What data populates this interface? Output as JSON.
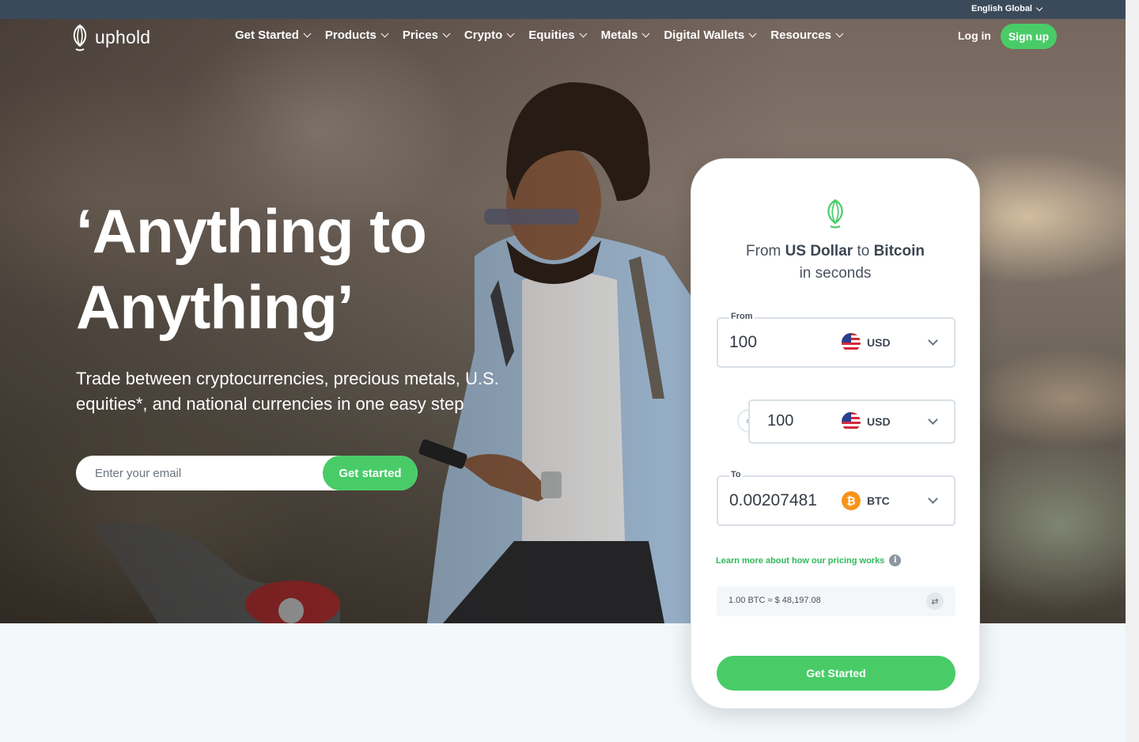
{
  "topbar": {
    "language": "English Global"
  },
  "header": {
    "brand": "uphold",
    "nav": [
      {
        "label": "Get Started"
      },
      {
        "label": "Products"
      },
      {
        "label": "Prices"
      },
      {
        "label": "Crypto"
      },
      {
        "label": "Equities"
      },
      {
        "label": "Metals"
      },
      {
        "label": "Digital Wallets"
      },
      {
        "label": "Resources"
      }
    ],
    "login": "Log in",
    "signup": "Sign up"
  },
  "hero": {
    "headline_line1": "‘Anything to",
    "headline_line2": "Anything’",
    "subtitle": "Trade between cryptocurrencies, precious metals, U.S. equities*, and national currencies in one easy step",
    "email_placeholder": "Enter your email",
    "cta": "Get started"
  },
  "converter": {
    "title_prefix": "From ",
    "title_from": "US Dollar",
    "title_mid": " to ",
    "title_to": "Bitcoin",
    "title_suffix": "in seconds",
    "from": {
      "label": "From",
      "value": "100",
      "currency": "USD"
    },
    "middle": {
      "value": "100",
      "currency": "USD"
    },
    "to": {
      "label": "To",
      "value": "0.00207481",
      "currency": "BTC"
    },
    "pricing_link": "Learn more about how our pricing works",
    "rate": "1.00 BTC ≈ $ 48,197.08",
    "cta": "Get Started"
  },
  "colors": {
    "brand_green": "#49cc68",
    "topbar": "#3b4a5a",
    "bitcoin": "#f7931a"
  }
}
